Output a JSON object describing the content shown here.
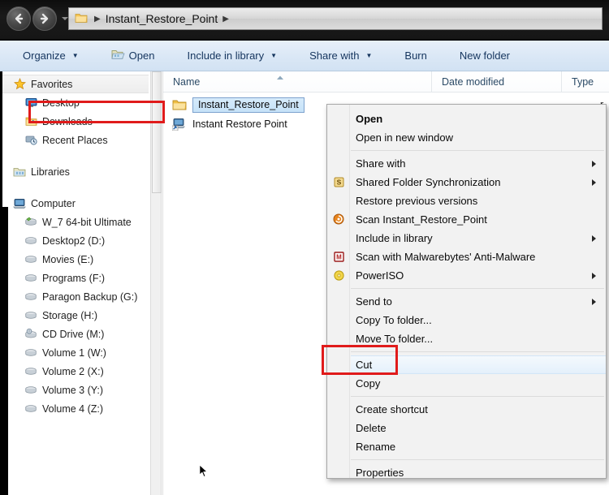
{
  "window": {
    "address_bar": {
      "breadcrumb": "Instant_Restore_Point",
      "folder_icon": "folder-icon",
      "back_icon": "back-arrow-icon",
      "forward_icon": "forward-arrow-icon",
      "dropdown_icon": "recent-locations-chevron-icon"
    }
  },
  "toolbar": {
    "items": [
      {
        "label": "Organize",
        "caret": true,
        "icon": null
      },
      {
        "label": "Open",
        "caret": false,
        "icon": "open-folder-icon"
      },
      {
        "label": "Include in library",
        "caret": true,
        "icon": null
      },
      {
        "label": "Share with",
        "caret": true,
        "icon": null
      },
      {
        "label": "Burn",
        "caret": false,
        "icon": null
      },
      {
        "label": "New folder",
        "caret": false,
        "icon": null
      }
    ]
  },
  "sidebar": {
    "groups": [
      {
        "header": {
          "label": "Favorites",
          "icon": "star-icon",
          "selected": true
        },
        "items": [
          {
            "label": "Desktop",
            "icon": "desktop-icon"
          },
          {
            "label": "Downloads",
            "icon": "downloads-folder-icon"
          },
          {
            "label": "Recent Places",
            "icon": "recent-places-icon"
          }
        ]
      },
      {
        "header": {
          "label": "Libraries",
          "icon": "libraries-icon",
          "selected": false
        },
        "items": []
      },
      {
        "header": {
          "label": "Computer",
          "icon": "computer-icon",
          "selected": false
        },
        "items": [
          {
            "label": "W_7 64-bit Ultimate",
            "icon": "system-drive-icon"
          },
          {
            "label": "Desktop2 (D:)",
            "icon": "drive-icon"
          },
          {
            "label": "Movies (E:)",
            "icon": "drive-icon"
          },
          {
            "label": "Programs (F:)",
            "icon": "drive-icon"
          },
          {
            "label": "Paragon Backup (G:)",
            "icon": "drive-icon"
          },
          {
            "label": "Storage (H:)",
            "icon": "drive-icon"
          },
          {
            "label": "CD Drive (M:)",
            "icon": "cd-drive-icon"
          },
          {
            "label": "Volume 1 (W:)",
            "icon": "drive-icon"
          },
          {
            "label": "Volume 2 (X:)",
            "icon": "drive-icon"
          },
          {
            "label": "Volume 3 (Y:)",
            "icon": "drive-icon"
          },
          {
            "label": "Volume 4 (Z:)",
            "icon": "drive-icon"
          }
        ]
      }
    ]
  },
  "file_list": {
    "columns": [
      {
        "key": "name",
        "label": "Name",
        "sorted": "asc"
      },
      {
        "key": "date",
        "label": "Date modified",
        "sorted": null
      },
      {
        "key": "type",
        "label": "Type",
        "sorted": null
      }
    ],
    "rows": [
      {
        "name": "Instant_Restore_Point",
        "icon": "folder-icon",
        "selected": true,
        "date": "",
        "type_fragment": "r"
      },
      {
        "name": "Instant Restore Point",
        "icon": "shortcut-icon",
        "selected": false,
        "date": "",
        "type_fragment": ""
      }
    ]
  },
  "context_menu": {
    "items": [
      {
        "label": "Open",
        "bold": true,
        "submenu": false,
        "icon": null,
        "separator_after": false
      },
      {
        "label": "Open in new window",
        "bold": false,
        "submenu": false,
        "icon": null,
        "separator_after": true
      },
      {
        "label": "Share with",
        "bold": false,
        "submenu": true,
        "icon": null,
        "separator_after": false
      },
      {
        "label": "Shared Folder Synchronization",
        "bold": false,
        "submenu": true,
        "icon": "sync-s-icon",
        "separator_after": false
      },
      {
        "label": "Restore previous versions",
        "bold": false,
        "submenu": false,
        "icon": null,
        "separator_after": false
      },
      {
        "label": "Scan Instant_Restore_Point",
        "bold": false,
        "submenu": false,
        "icon": "antivirus-scan-icon",
        "separator_after": false
      },
      {
        "label": "Include in library",
        "bold": false,
        "submenu": true,
        "icon": null,
        "separator_after": false
      },
      {
        "label": "Scan with Malwarebytes' Anti-Malware",
        "bold": false,
        "submenu": false,
        "icon": "malwarebytes-icon",
        "separator_after": false
      },
      {
        "label": "PowerISO",
        "bold": false,
        "submenu": true,
        "icon": "poweriso-icon",
        "separator_after": true
      },
      {
        "label": "Send to",
        "bold": false,
        "submenu": true,
        "icon": null,
        "separator_after": false
      },
      {
        "label": "Copy To folder...",
        "bold": false,
        "submenu": false,
        "icon": null,
        "separator_after": false
      },
      {
        "label": "Move To folder...",
        "bold": false,
        "submenu": false,
        "icon": null,
        "separator_after": true
      },
      {
        "label": "Cut",
        "bold": false,
        "submenu": false,
        "icon": null,
        "separator_after": false,
        "highlighted": true
      },
      {
        "label": "Copy",
        "bold": false,
        "submenu": false,
        "icon": null,
        "separator_after": true
      },
      {
        "label": "Create shortcut",
        "bold": false,
        "submenu": false,
        "icon": null,
        "separator_after": false
      },
      {
        "label": "Delete",
        "bold": false,
        "submenu": false,
        "icon": null,
        "separator_after": false
      },
      {
        "label": "Rename",
        "bold": false,
        "submenu": false,
        "icon": null,
        "separator_after": true
      },
      {
        "label": "Properties",
        "bold": false,
        "submenu": false,
        "icon": null,
        "separator_after": false
      }
    ]
  },
  "annotations": {
    "color": "#e01b1b",
    "selection_highlight": "Instant_Restore_Point",
    "action_highlight": "Cut"
  },
  "colors": {
    "toolbar_bg": "#dbe8f6",
    "selection_blue": "#c6e2f8",
    "menu_bg": "#f2f2f2",
    "annotation_red": "#e01b1b",
    "titlebar_black": "#141414"
  }
}
